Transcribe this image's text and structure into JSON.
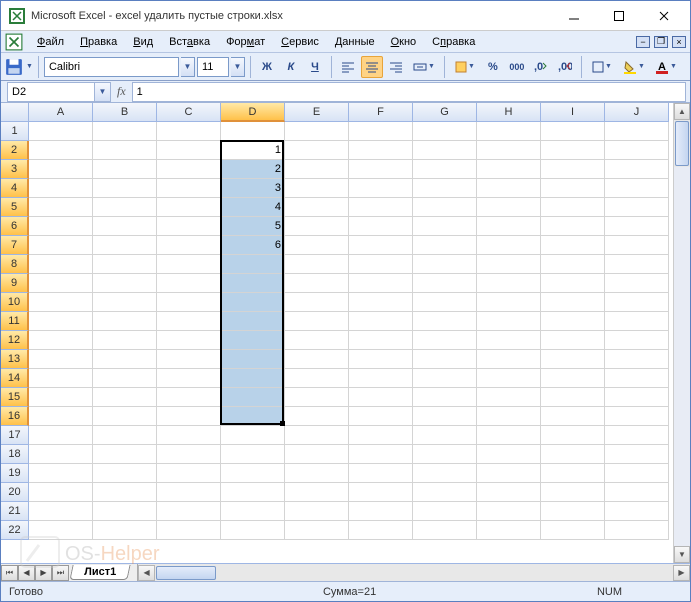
{
  "window": {
    "title": "Microsoft Excel - excel удалить пустые строки.xlsx"
  },
  "menu_bar": {
    "items": [
      {
        "text": "Файл",
        "u": "Ф"
      },
      {
        "text": "Правка",
        "u": "П"
      },
      {
        "text": "Вид",
        "u": "В"
      },
      {
        "text": "Вставка",
        "u": "а"
      },
      {
        "text": "Формат",
        "u": "м"
      },
      {
        "text": "Сервис",
        "u": "С"
      },
      {
        "text": "Данные",
        "u": "Д"
      },
      {
        "text": "Окно",
        "u": "О"
      },
      {
        "text": "Справка",
        "u": "п"
      }
    ]
  },
  "toolbar": {
    "font_name": "Calibri",
    "font_size": "11",
    "bold": "Ж",
    "italic": "К",
    "underline": "Ч"
  },
  "name_box": "D2",
  "fx_label": "fx",
  "formula": "1",
  "columns": [
    "A",
    "B",
    "C",
    "D",
    "E",
    "F",
    "G",
    "H",
    "I",
    "J"
  ],
  "rows": [
    "1",
    "2",
    "3",
    "4",
    "5",
    "6",
    "7",
    "8",
    "9",
    "10",
    "11",
    "12",
    "13",
    "14",
    "15",
    "16",
    "17",
    "18",
    "19",
    "20",
    "21",
    "22"
  ],
  "selected_column_index": 3,
  "selected_rows_from": 1,
  "selected_rows_to": 15,
  "cells": {
    "D2": "1",
    "D3": "2",
    "D4": "3",
    "D5": "4",
    "D6": "5",
    "D7": "6"
  },
  "chart_data": {
    "type": "table",
    "columns": [
      "D"
    ],
    "rows": [
      {
        "D": 1
      },
      {
        "D": 2
      },
      {
        "D": 3
      },
      {
        "D": 4
      },
      {
        "D": 5
      },
      {
        "D": 6
      }
    ]
  },
  "sheet_tabs": [
    "Лист1"
  ],
  "status": {
    "ready": "Готово",
    "sum": "Сумма=21",
    "num": "NUM"
  },
  "watermark": {
    "left": "OS-",
    "right": "Helper"
  }
}
